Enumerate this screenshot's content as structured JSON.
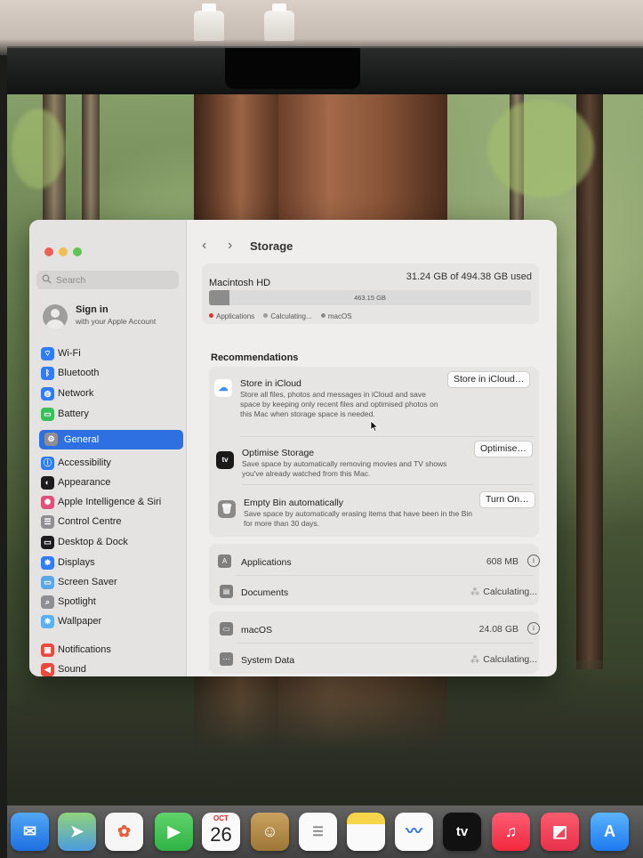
{
  "window_title": "Storage",
  "search": {
    "placeholder": "Search"
  },
  "account": {
    "title": "Sign in",
    "subtitle": "with your Apple Account"
  },
  "sidebar_items": [
    {
      "label": "Wi-Fi",
      "icon": "wifi-icon",
      "color": "#2f7cf6",
      "glyph": "⌔"
    },
    {
      "label": "Bluetooth",
      "icon": "bluetooth-icon",
      "color": "#2f7cf6",
      "glyph": "ᛒ"
    },
    {
      "label": "Network",
      "icon": "globe-icon",
      "color": "#2f7cf6",
      "glyph": "◍"
    },
    {
      "label": "Battery",
      "icon": "battery-icon",
      "color": "#37c05a",
      "glyph": "▭"
    },
    {
      "label": "General",
      "icon": "gear-icon",
      "color": "#8e8e93",
      "glyph": "⚙",
      "selected": true
    },
    {
      "label": "Accessibility",
      "icon": "accessibility-icon",
      "color": "#2f7cf6",
      "glyph": "ⓘ"
    },
    {
      "label": "Appearance",
      "icon": "appearance-icon",
      "color": "#1c1c1e",
      "glyph": "◐"
    },
    {
      "label": "Apple Intelligence & Siri",
      "icon": "siri-icon",
      "color": "#e0507a",
      "glyph": "✺"
    },
    {
      "label": "Control Centre",
      "icon": "control-centre-icon",
      "color": "#8e8e93",
      "glyph": "☰"
    },
    {
      "label": "Desktop & Dock",
      "icon": "desktop-dock-icon",
      "color": "#1c1c1e",
      "glyph": "▭"
    },
    {
      "label": "Displays",
      "icon": "displays-icon",
      "color": "#2f7cf6",
      "glyph": "✹"
    },
    {
      "label": "Screen Saver",
      "icon": "screen-saver-icon",
      "color": "#5aa7e6",
      "glyph": "▭"
    },
    {
      "label": "Spotlight",
      "icon": "spotlight-icon",
      "color": "#8e8e93",
      "glyph": "⌕"
    },
    {
      "label": "Wallpaper",
      "icon": "wallpaper-icon",
      "color": "#5ab0f0",
      "glyph": "❋"
    },
    {
      "label": "Notifications",
      "icon": "notifications-icon",
      "color": "#ea4a3d",
      "glyph": "▣"
    },
    {
      "label": "Sound",
      "icon": "sound-icon",
      "color": "#ea4a3d",
      "glyph": "◀"
    }
  ],
  "storage": {
    "disk_name": "Macintosh HD",
    "used_text": "31.24 GB of 494.38 GB used",
    "used_fraction": 0.063,
    "free_label": "463.15 GB",
    "legend": [
      {
        "label": "Applications",
        "color": "#e0302a"
      },
      {
        "label": "Calculating...",
        "color": "#9a9a9a"
      },
      {
        "label": "macOS",
        "color": "#8a8a8a"
      }
    ]
  },
  "recommendations": {
    "title": "Recommendations",
    "items": [
      {
        "title": "Store in iCloud",
        "desc": "Store all files, photos and messages in iCloud and save space by keeping only recent files and optimised photos on this Mac when storage space is needed.",
        "button": "Store in iCloud…"
      },
      {
        "title": "Optimise Storage",
        "desc": "Save space by automatically removing movies and TV shows you've already watched from this Mac.",
        "button": "Optimise…"
      },
      {
        "title": "Empty Bin automatically",
        "desc": "Save space by automatically erasing items that have been in the Bin for more than 30 days.",
        "button": "Turn On…"
      }
    ]
  },
  "categories": [
    {
      "label": "Applications",
      "value": "608 MB"
    },
    {
      "label": "Documents",
      "value": "Calculating..."
    },
    {
      "label": "macOS",
      "value": "24.08 GB"
    },
    {
      "label": "System Data",
      "value": "Calculating..."
    }
  ],
  "dock": {
    "calendar_month": "OCT",
    "calendar_day": "26",
    "tv_label": "tv"
  }
}
